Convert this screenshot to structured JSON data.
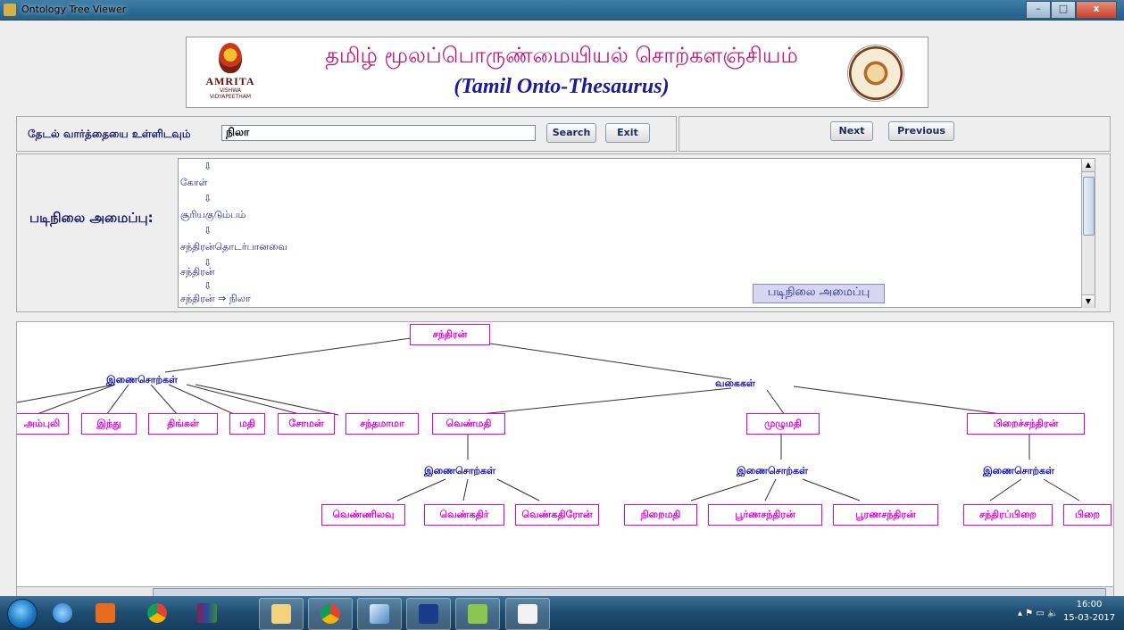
{
  "window": {
    "title": "Ontology Tree Viewer",
    "close_label": "x",
    "min_label": "–",
    "max_label": "□"
  },
  "banner": {
    "tamil_title": "தமிழ் மூலப்பொருண்மையியல் சொற்களஞ்சியம்",
    "english_title": "(Tamil Onto-Thesaurus)",
    "logo_name": "AMRITA",
    "logo_subtext": "VISHWA VIDYAPEETHAM"
  },
  "search": {
    "label": "தேடல் வார்த்தையை உள்ளிடவும்",
    "value": "நிலா",
    "search_button": "Search",
    "exit_button": "Exit"
  },
  "nav": {
    "next_button": "Next",
    "previous_button": "Previous"
  },
  "hierarchy": {
    "label": "படிநிலை அமைப்பு:",
    "lines": [
      "⇩",
      "கோள்",
      "⇩",
      "சூரியகுடும்பம்",
      "⇩",
      "சந்திரன்தொடர்பானவை",
      "⇩",
      "சந்திரன்",
      "⇩",
      "சந்திரன் ⇒ நிலா"
    ],
    "badge": "படிநிலை அமைப்பு"
  },
  "tree": {
    "root": "சந்திரன்",
    "group_synonyms": "இணைசொற்கள்",
    "group_types": "வகைகள்",
    "synonyms": [
      "அம்புலி",
      "இந்து",
      "திங்கள்",
      "மதி",
      "சோமன்",
      "சந்தமாமா"
    ],
    "types": [
      "வெண்மதி",
      "முழுமதி",
      "பிறைச்சந்திரன்"
    ],
    "venmathi_synonyms": [
      "வெண்ணிலவு",
      "வெண்கதிர்",
      "வெண்கதிரோன்"
    ],
    "muzhumathi_synonyms": [
      "நிறைமதி",
      "பூர்ணசந்திரன்",
      "பூரணசந்திரன்"
    ],
    "pirai_synonyms": [
      "சந்திரப்பிறை",
      "பிறை"
    ]
  },
  "taskbar": {
    "time": "16:00",
    "date": "15-03-2017",
    "apps": [
      "ie-icon",
      "media-player-icon",
      "chrome-icon",
      "winrar-icon",
      "file-explorer-icon",
      "chrome-app-icon",
      "virtualbox-icon",
      "butterfly-app-icon",
      "notepad-plus-icon",
      "java-icon"
    ],
    "tray_icons": "▴  ⚑  ▭  🔈"
  }
}
